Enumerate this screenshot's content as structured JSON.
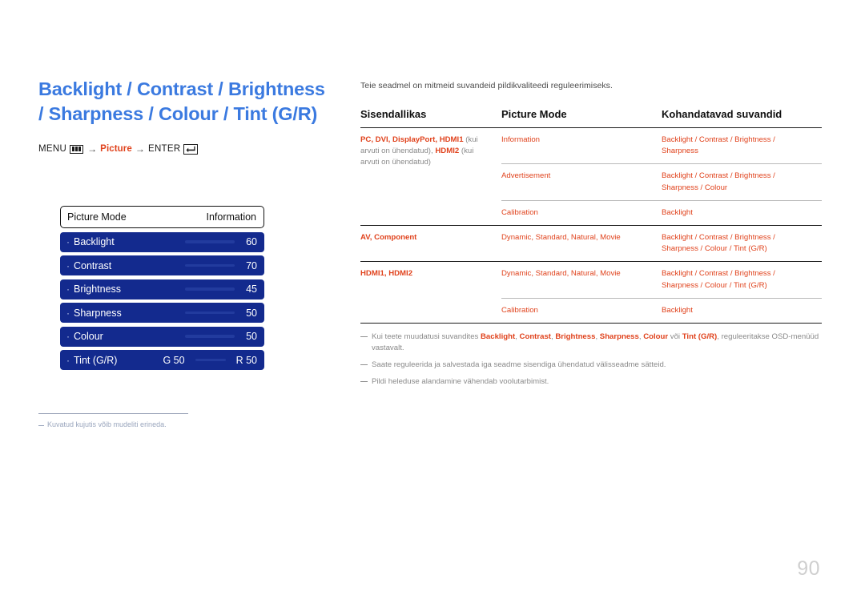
{
  "title": "Backlight / Contrast / Brightness / Sharpness / Colour / Tint (G/R)",
  "nav": {
    "menu_label": "MENU",
    "menu_icon": "menu-bars-icon",
    "arrow": "→",
    "picture_label": "Picture",
    "enter_label": "ENTER",
    "enter_icon": "enter-return-icon"
  },
  "osd": {
    "header": {
      "label": "Picture Mode",
      "value": "Information"
    },
    "rows": [
      {
        "bullet": "·",
        "label": "Backlight",
        "value": "60",
        "type": "slider"
      },
      {
        "bullet": "·",
        "label": "Contrast",
        "value": "70",
        "type": "slider"
      },
      {
        "bullet": "·",
        "label": "Brightness",
        "value": "45",
        "type": "slider"
      },
      {
        "bullet": "·",
        "label": "Sharpness",
        "value": "50",
        "type": "slider"
      },
      {
        "bullet": "·",
        "label": "Colour",
        "value": "50",
        "type": "slider"
      },
      {
        "bullet": "·",
        "label": "Tint (G/R)",
        "left_value": "G 50",
        "value": "R 50",
        "type": "dual"
      }
    ]
  },
  "left_note": "Kuvatud kujutis võib mudeliti erineda.",
  "intro": "Teie seadmel on mitmeid suvandeid pildikvaliteedi reguleerimiseks.",
  "table": {
    "headers": [
      "Sisendallikas",
      "Picture Mode",
      "Kohandatavad suvandid"
    ],
    "groups": [
      {
        "source_parts": [
          {
            "t": "PC",
            "s": "b"
          },
          {
            "t": ", ",
            "s": "b"
          },
          {
            "t": "DVI",
            "s": "b"
          },
          {
            "t": ", ",
            "s": "b"
          },
          {
            "t": "DisplayPort",
            "s": "b"
          },
          {
            "t": ", ",
            "s": "b"
          },
          {
            "t": "HDMI1",
            "s": "b"
          },
          {
            "t": " (kui arvuti on ühendatud), ",
            "s": "g"
          },
          {
            "t": "HDMI2",
            "s": "b"
          },
          {
            "t": " (kui arvuti on ühendatud)",
            "s": "g"
          }
        ],
        "source_plain": "PC, DVI, DisplayPort, HDMI1 (kui arvuti on ühendatud), HDMI2 (kui arvuti on ühendatud)",
        "rows": [
          {
            "mode": "Information",
            "options": "Backlight / Contrast / Brightness / Sharpness"
          },
          {
            "mode": "Advertisement",
            "options": "Backlight / Contrast / Brightness / Sharpness / Colour"
          },
          {
            "mode": "Calibration",
            "options": "Backlight"
          }
        ]
      },
      {
        "source_parts": [
          {
            "t": "AV",
            "s": "b"
          },
          {
            "t": ", ",
            "s": "b"
          },
          {
            "t": "Component",
            "s": "b"
          }
        ],
        "source_plain": "AV, Component",
        "rows": [
          {
            "mode": "Dynamic, Standard, Natural, Movie",
            "options": "Backlight / Contrast / Brightness / Sharpness / Colour / Tint (G/R)"
          }
        ]
      },
      {
        "source_parts": [
          {
            "t": "HDMI1",
            "s": "b"
          },
          {
            "t": ", ",
            "s": "b"
          },
          {
            "t": "HDMI2",
            "s": "b"
          }
        ],
        "source_plain": "HDMI1, HDMI2",
        "rows": [
          {
            "mode": "Dynamic, Standard, Natural, Movie",
            "options": "Backlight / Contrast / Brightness / Sharpness / Colour / Tint (G/R)"
          },
          {
            "mode": "Calibration",
            "options": "Backlight"
          }
        ]
      }
    ]
  },
  "footnotes": [
    {
      "parts": [
        {
          "t": "Kui teete muudatusi suvandites ",
          "s": "g"
        },
        {
          "t": "Backlight",
          "s": "b"
        },
        {
          "t": ", ",
          "s": "g"
        },
        {
          "t": "Contrast",
          "s": "b"
        },
        {
          "t": ", ",
          "s": "g"
        },
        {
          "t": "Brightness",
          "s": "b"
        },
        {
          "t": ", ",
          "s": "g"
        },
        {
          "t": "Sharpness",
          "s": "b"
        },
        {
          "t": ", ",
          "s": "g"
        },
        {
          "t": "Colour",
          "s": "b"
        },
        {
          "t": "  või ",
          "s": "g"
        },
        {
          "t": "Tint (G/R)",
          "s": "b"
        },
        {
          "t": ", reguleeritakse OSD-menüüd vastavalt.",
          "s": "g"
        }
      ],
      "plain": "Kui teete muudatusi suvandites Backlight, Contrast, Brightness, Sharpness, Colour  või Tint (G/R), reguleeritakse OSD-menüüd vastavalt."
    },
    {
      "parts": [
        {
          "t": "Saate reguleerida ja salvestada iga seadme sisendiga ühendatud välisseadme sätteid.",
          "s": "g"
        }
      ],
      "plain": "Saate reguleerida ja salvestada iga seadme sisendiga ühendatud välisseadme sätteid."
    },
    {
      "parts": [
        {
          "t": "Pildi heleduse alandamine vähendab voolutarbimist.",
          "s": "g"
        }
      ],
      "plain": "Pildi heleduse alandamine vähendab voolutarbimist."
    }
  ],
  "page_number": "90",
  "colors": {
    "title_blue": "#3b7ae0",
    "accent_orange": "#e0421c",
    "osd_blue": "#132a8e",
    "body_gray": "#7a7a7a",
    "page_number_gray": "#cfcfcf"
  }
}
